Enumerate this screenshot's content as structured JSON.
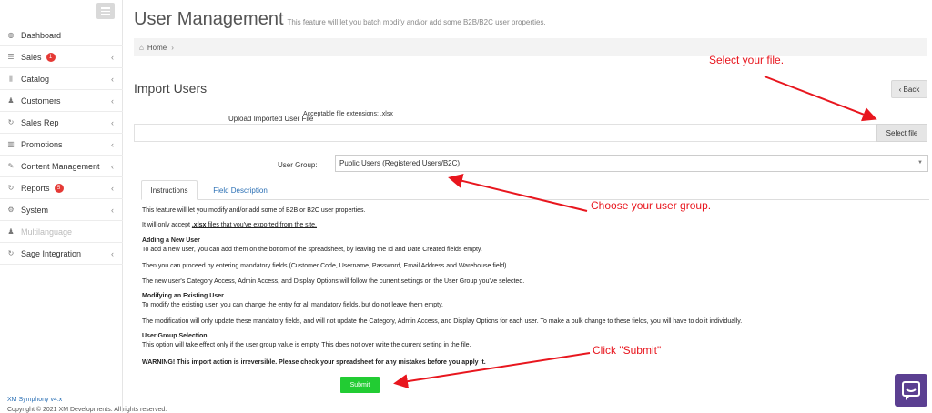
{
  "sidebar": {
    "items": [
      {
        "icon": "dashboard-icon",
        "glyph": "◍",
        "label": "Dashboard",
        "badge": "",
        "chevron": ""
      },
      {
        "icon": "sales-icon",
        "glyph": "☰",
        "label": "Sales",
        "badge": "1",
        "chevron": "‹"
      },
      {
        "icon": "catalog-icon",
        "glyph": "⫼",
        "label": "Catalog",
        "badge": "",
        "chevron": "‹"
      },
      {
        "icon": "customers-icon",
        "glyph": "♟",
        "label": "Customers",
        "badge": "",
        "chevron": "‹"
      },
      {
        "icon": "sales-rep-icon",
        "glyph": "↻",
        "label": "Sales Rep",
        "badge": "",
        "chevron": "‹"
      },
      {
        "icon": "promotions-icon",
        "glyph": "▥",
        "label": "Promotions",
        "badge": "",
        "chevron": "‹"
      },
      {
        "icon": "content-management-icon",
        "glyph": "✎",
        "label": "Content Management",
        "badge": "",
        "chevron": "‹"
      },
      {
        "icon": "reports-icon",
        "glyph": "↻",
        "label": "Reports",
        "badge": "5",
        "chevron": "‹"
      },
      {
        "icon": "system-icon",
        "glyph": "⚙",
        "label": "System",
        "badge": "",
        "chevron": "‹"
      },
      {
        "icon": "multilanguage-icon",
        "glyph": "♟",
        "label": "Multilanguage",
        "badge": "",
        "chevron": ""
      },
      {
        "icon": "sage-integration-icon",
        "glyph": "↻",
        "label": "Sage Integration",
        "badge": "",
        "chevron": "‹"
      }
    ],
    "footer_version": "XM Symphony  v4.x",
    "footer_copyright": "Copyright © 2021 XM Developments. All rights reserved."
  },
  "header": {
    "title": "User Management",
    "subtitle": "This feature will let you batch modify and/or add some B2B/B2C user properties.",
    "breadcrumb_home": "Home",
    "breadcrumb_sep": "›"
  },
  "import": {
    "title": "Import Users",
    "back_label": "‹ Back",
    "upload_label": "Upload Imported User File",
    "extensions_note": "Acceptable file extensions: .xlsx",
    "file_value": "",
    "select_file_label": "Select file",
    "group_label": "User Group:",
    "group_value": "Public Users (Registered Users/B2C)"
  },
  "tabs": {
    "instructions": "Instructions",
    "field_description": "Field Description"
  },
  "instructions": {
    "line1": "This feature will let you modify and/or add some of B2B or B2C user properties.",
    "line2_prefix": "It will only accept ",
    "line2_ext": ".xlsx",
    "line2_link": " files that you've exported from the site.",
    "adding_title": "Adding a New User",
    "adding_1": "To add a new user, you can add them on the bottom of the spreadsheet, by leaving the Id and Date Created fields empty.",
    "adding_2": "Then you can proceed by entering mandatory fields (Customer Code, Username, Password, Email Address and Warehouse field).",
    "adding_3": "The new user's Category Access, Admin Access, and Display Options will follow the current settings on the User Group you've selected.",
    "modifying_title": "Modifying an Existing User",
    "modifying_1": "To modify the existing user, you can change the entry for all mandatory fields, but do not leave them empty.",
    "modifying_2": "The modification will only update these mandatory fields, and will not update the Category, Admin Access, and Display Options for each user. To make a bulk change to these fields, you will have to do it individually.",
    "group_sel_title": "User Group Selection",
    "group_sel_1": "This option will take effect only if the user group value is empty. This does not over write the current setting in the file.",
    "warning": "WARNING! This import action is irreversible. Please check your spreadsheet for any mistakes before you apply it."
  },
  "submit_label": "Submit",
  "annotations": {
    "select_file": "Select your file.",
    "choose_group": "Choose your user group.",
    "click_submit": "Click \"Submit\""
  },
  "colors": {
    "annotation_red": "#e8161e",
    "submit_green": "#22cc33",
    "link_blue": "#2a6fb4",
    "chat_purple": "#5b3f91"
  }
}
